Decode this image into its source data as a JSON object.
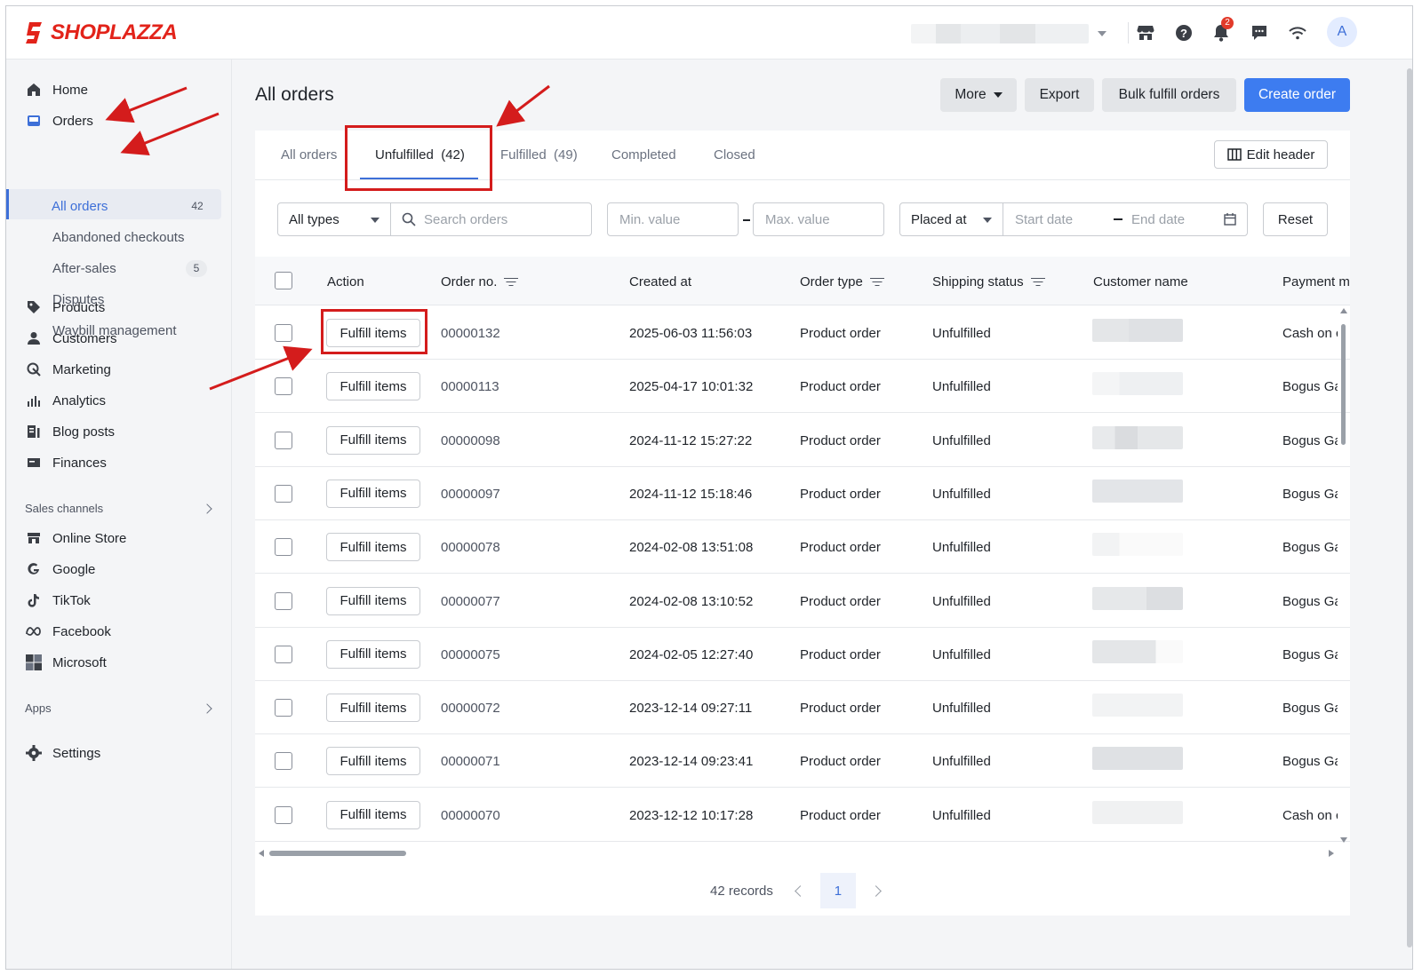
{
  "app": {
    "brand": "SHOPLAZZA",
    "notifications_count": "2",
    "avatar_letter": "A"
  },
  "sidebar": {
    "items": [
      {
        "label": "Home",
        "icon": "home-icon"
      },
      {
        "label": "Orders",
        "icon": "orders-icon"
      },
      {
        "label": "Products",
        "icon": "tag-icon"
      },
      {
        "label": "Customers",
        "icon": "person-icon"
      },
      {
        "label": "Marketing",
        "icon": "megaphone-icon"
      },
      {
        "label": "Analytics",
        "icon": "bar-chart-icon"
      },
      {
        "label": "Blog posts",
        "icon": "blog-icon"
      },
      {
        "label": "Finances",
        "icon": "finances-icon"
      }
    ],
    "orders_sub": [
      {
        "label": "All orders",
        "count": "42"
      },
      {
        "label": "Abandoned checkouts",
        "count": ""
      },
      {
        "label": "After-sales",
        "count": "5"
      },
      {
        "label": "Disputes",
        "count": ""
      },
      {
        "label": "Waybill management",
        "count": ""
      }
    ],
    "sales_channels_label": "Sales channels",
    "channels": [
      {
        "label": "Online Store",
        "icon": "store-icon"
      },
      {
        "label": "Google",
        "icon": "google-icon"
      },
      {
        "label": "TikTok",
        "icon": "tiktok-icon"
      },
      {
        "label": "Facebook",
        "icon": "meta-icon"
      },
      {
        "label": "Microsoft",
        "icon": "microsoft-icon"
      }
    ],
    "apps_label": "Apps",
    "settings_label": "Settings"
  },
  "page": {
    "title": "All orders",
    "actions": {
      "more": "More",
      "export": "Export",
      "bulk": "Bulk fulfill orders",
      "create": "Create order"
    }
  },
  "tabs": [
    {
      "label": "All orders"
    },
    {
      "label": "Unfulfilled  (42)"
    },
    {
      "label": "Fulfilled  (49)"
    },
    {
      "label": "Completed"
    },
    {
      "label": "Closed"
    }
  ],
  "edit_header": "Edit header",
  "filters": {
    "type_value": "All types",
    "search_placeholder": "Search orders",
    "min_placeholder": "Min. value",
    "max_placeholder": "Max. value",
    "date_field": "Placed at",
    "start_placeholder": "Start date",
    "end_placeholder": "End date",
    "reset": "Reset"
  },
  "table": {
    "headers": {
      "action": "Action",
      "order_no": "Order no.",
      "created_at": "Created at",
      "order_type": "Order type",
      "shipping_status": "Shipping status",
      "customer_name": "Customer name",
      "payment": "Payment m"
    },
    "action_label": "Fulfill items",
    "rows": [
      {
        "order_no": "00000132",
        "created_at": "2025-06-03 11:56:03",
        "order_type": "Product order",
        "shipping": "Unfulfilled",
        "payment": "Cash on c"
      },
      {
        "order_no": "00000113",
        "created_at": "2025-04-17 10:01:32",
        "order_type": "Product order",
        "shipping": "Unfulfilled",
        "payment": "Bogus Ga"
      },
      {
        "order_no": "00000098",
        "created_at": "2024-11-12 15:27:22",
        "order_type": "Product order",
        "shipping": "Unfulfilled",
        "payment": "Bogus Ga"
      },
      {
        "order_no": "00000097",
        "created_at": "2024-11-12 15:18:46",
        "order_type": "Product order",
        "shipping": "Unfulfilled",
        "payment": "Bogus Ga"
      },
      {
        "order_no": "00000078",
        "created_at": "2024-02-08 13:51:08",
        "order_type": "Product order",
        "shipping": "Unfulfilled",
        "payment": "Bogus Ga"
      },
      {
        "order_no": "00000077",
        "created_at": "2024-02-08 13:10:52",
        "order_type": "Product order",
        "shipping": "Unfulfilled",
        "payment": "Bogus Ga"
      },
      {
        "order_no": "00000075",
        "created_at": "2024-02-05 12:27:40",
        "order_type": "Product order",
        "shipping": "Unfulfilled",
        "payment": "Bogus Ga"
      },
      {
        "order_no": "00000072",
        "created_at": "2023-12-14 09:27:11",
        "order_type": "Product order",
        "shipping": "Unfulfilled",
        "payment": "Bogus Ga"
      },
      {
        "order_no": "00000071",
        "created_at": "2023-12-14 09:23:41",
        "order_type": "Product order",
        "shipping": "Unfulfilled",
        "payment": "Bogus Ga"
      },
      {
        "order_no": "00000070",
        "created_at": "2023-12-12 10:17:28",
        "order_type": "Product order",
        "shipping": "Unfulfilled",
        "payment": "Cash on c"
      }
    ]
  },
  "pagination": {
    "records": "42 records",
    "current_page": "1"
  },
  "colors": {
    "accent": "#3d6fd8",
    "primary_button": "#3d7cf0",
    "annotation_red": "#d41c1c",
    "brand_red": "#e2231a"
  }
}
